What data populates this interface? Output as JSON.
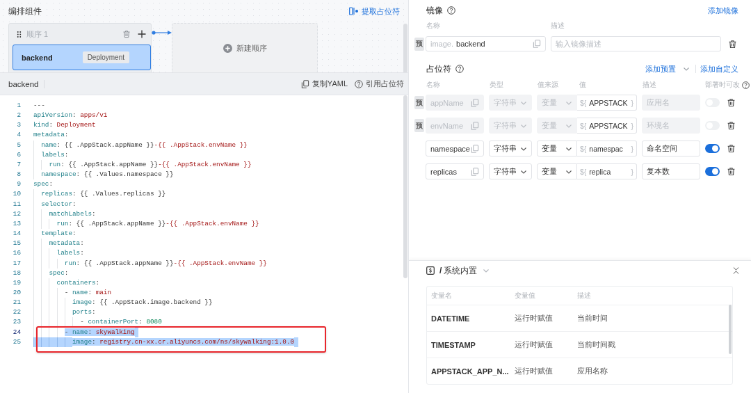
{
  "canvas": {
    "title": "编排组件",
    "extract_link": "提取占位符",
    "stages": [
      {
        "title": "顺序 1",
        "components": [
          {
            "name": "backend",
            "kind_tag": "Deployment",
            "selected": true
          }
        ]
      }
    ],
    "new_stage": "新建顺序"
  },
  "editor": {
    "title": "backend",
    "actions": [
      {
        "kind": "copy",
        "label": "复制YAML"
      },
      {
        "kind": "help",
        "label": "引用占位符"
      }
    ],
    "lines": [
      {
        "number": "1",
        "tokens": [
          {
            "kind": "punct",
            "text": "---"
          }
        ],
        "selected": false,
        "current": false,
        "outlined": false
      },
      {
        "number": "2",
        "tokens": [
          {
            "kind": "key",
            "text": "apiVersion"
          },
          {
            "kind": "punct",
            "text": ": "
          },
          {
            "kind": "string",
            "text": "apps/v1"
          }
        ],
        "selected": false,
        "current": false,
        "outlined": false
      },
      {
        "number": "3",
        "tokens": [
          {
            "kind": "key",
            "text": "kind"
          },
          {
            "kind": "punct",
            "text": ": "
          },
          {
            "kind": "string",
            "text": "Deployment"
          }
        ],
        "selected": false,
        "current": false,
        "outlined": false
      },
      {
        "number": "4",
        "tokens": [
          {
            "kind": "key",
            "text": "metadata"
          },
          {
            "kind": "punct",
            "text": ":"
          }
        ],
        "selected": false,
        "current": false,
        "outlined": false
      },
      {
        "number": "5",
        "tokens": [
          {
            "kind": "key",
            "text": "  name"
          },
          {
            "kind": "punct",
            "text": ": "
          },
          {
            "kind": "template",
            "text": "{{ .AppStack.appName }}"
          },
          {
            "kind": "string",
            "text": "-{{ .AppStack.envName }}"
          }
        ],
        "selected": false,
        "current": false,
        "outlined": false
      },
      {
        "number": "6",
        "tokens": [
          {
            "kind": "key",
            "text": "  labels"
          },
          {
            "kind": "punct",
            "text": ":"
          }
        ],
        "selected": false,
        "current": false,
        "outlined": false
      },
      {
        "number": "7",
        "tokens": [
          {
            "kind": "key",
            "text": "    run"
          },
          {
            "kind": "punct",
            "text": ": "
          },
          {
            "kind": "template",
            "text": "{{ .AppStack.appName }}"
          },
          {
            "kind": "string",
            "text": "-{{ .AppStack.envName }}"
          }
        ],
        "selected": false,
        "current": false,
        "outlined": false
      },
      {
        "number": "8",
        "tokens": [
          {
            "kind": "key",
            "text": "  namespace"
          },
          {
            "kind": "punct",
            "text": ": "
          },
          {
            "kind": "template",
            "text": "{{ .Values.namespace }}"
          }
        ],
        "selected": false,
        "current": false,
        "outlined": false
      },
      {
        "number": "9",
        "tokens": [
          {
            "kind": "key",
            "text": "spec"
          },
          {
            "kind": "punct",
            "text": ":"
          }
        ],
        "selected": false,
        "current": false,
        "outlined": false
      },
      {
        "number": "10",
        "tokens": [
          {
            "kind": "key",
            "text": "  replicas"
          },
          {
            "kind": "punct",
            "text": ": "
          },
          {
            "kind": "template",
            "text": "{{ .Values.replicas }}"
          }
        ],
        "selected": false,
        "current": false,
        "outlined": false
      },
      {
        "number": "11",
        "tokens": [
          {
            "kind": "key",
            "text": "  selector"
          },
          {
            "kind": "punct",
            "text": ":"
          }
        ],
        "selected": false,
        "current": false,
        "outlined": false
      },
      {
        "number": "12",
        "tokens": [
          {
            "kind": "key",
            "text": "    matchLabels"
          },
          {
            "kind": "punct",
            "text": ":"
          }
        ],
        "selected": false,
        "current": false,
        "outlined": false
      },
      {
        "number": "13",
        "tokens": [
          {
            "kind": "key",
            "text": "      run"
          },
          {
            "kind": "punct",
            "text": ": "
          },
          {
            "kind": "template",
            "text": "{{ .AppStack.appName }}"
          },
          {
            "kind": "string",
            "text": "-{{ .AppStack.envName }}"
          }
        ],
        "selected": false,
        "current": false,
        "outlined": false
      },
      {
        "number": "14",
        "tokens": [
          {
            "kind": "key",
            "text": "  template"
          },
          {
            "kind": "punct",
            "text": ":"
          }
        ],
        "selected": false,
        "current": false,
        "outlined": false
      },
      {
        "number": "15",
        "tokens": [
          {
            "kind": "key",
            "text": "    metadata"
          },
          {
            "kind": "punct",
            "text": ":"
          }
        ],
        "selected": false,
        "current": false,
        "outlined": false
      },
      {
        "number": "16",
        "tokens": [
          {
            "kind": "key",
            "text": "      labels"
          },
          {
            "kind": "punct",
            "text": ":"
          }
        ],
        "selected": false,
        "current": false,
        "outlined": false
      },
      {
        "number": "17",
        "tokens": [
          {
            "kind": "key",
            "text": "        run"
          },
          {
            "kind": "punct",
            "text": ": "
          },
          {
            "kind": "template",
            "text": "{{ .AppStack.appName }}"
          },
          {
            "kind": "string",
            "text": "-{{ .AppStack.envName }}"
          }
        ],
        "selected": false,
        "current": false,
        "outlined": false
      },
      {
        "number": "18",
        "tokens": [
          {
            "kind": "key",
            "text": "    spec"
          },
          {
            "kind": "punct",
            "text": ":"
          }
        ],
        "selected": false,
        "current": false,
        "outlined": false
      },
      {
        "number": "19",
        "tokens": [
          {
            "kind": "key",
            "text": "      containers"
          },
          {
            "kind": "punct",
            "text": ":"
          }
        ],
        "selected": false,
        "current": false,
        "outlined": false
      },
      {
        "number": "20",
        "tokens": [
          {
            "kind": "punct",
            "text": "        - "
          },
          {
            "kind": "key",
            "text": "name"
          },
          {
            "kind": "punct",
            "text": ": "
          },
          {
            "kind": "string",
            "text": "main"
          }
        ],
        "selected": false,
        "current": false,
        "outlined": false
      },
      {
        "number": "21",
        "tokens": [
          {
            "kind": "key",
            "text": "          image"
          },
          {
            "kind": "punct",
            "text": ": "
          },
          {
            "kind": "template",
            "text": "{{ .AppStack.image.backend }}"
          }
        ],
        "selected": false,
        "current": false,
        "outlined": false
      },
      {
        "number": "22",
        "tokens": [
          {
            "kind": "key",
            "text": "          ports"
          },
          {
            "kind": "punct",
            "text": ":"
          }
        ],
        "selected": false,
        "current": false,
        "outlined": false
      },
      {
        "number": "23",
        "tokens": [
          {
            "kind": "punct",
            "text": "            - "
          },
          {
            "kind": "key",
            "text": "containerPort"
          },
          {
            "kind": "punct",
            "text": ": "
          },
          {
            "kind": "number",
            "text": "8080"
          }
        ],
        "selected": false,
        "current": false,
        "outlined": false
      },
      {
        "number": "24",
        "tokens": [
          {
            "kind": "punct",
            "text": "        - "
          },
          {
            "kind": "key",
            "text": "name"
          },
          {
            "kind": "punct",
            "text": ": "
          },
          {
            "kind": "string",
            "text": "skywalking"
          }
        ],
        "selected": true,
        "current": true,
        "outlined": true
      },
      {
        "number": "25",
        "tokens": [
          {
            "kind": "key",
            "text": "          image"
          },
          {
            "kind": "punct",
            "text": ": "
          },
          {
            "kind": "string",
            "text": "registry.cn-xx.cr.aliyuncs.com/ns/skywalking:1.0.0"
          }
        ],
        "selected": true,
        "current": false,
        "outlined": true
      }
    ]
  },
  "image": {
    "title": "镜像",
    "add_link": "添加镜像",
    "columns": [
      "名称",
      "描述"
    ],
    "rows": [
      {
        "badge": "预",
        "prefix": "image.",
        "value": "backend",
        "description_placeholder": "输入镜像描述"
      }
    ]
  },
  "placeholders": {
    "title": "占位符",
    "add_preset": "添加预置",
    "add_custom": "添加自定义",
    "columns": [
      "名称",
      "类型",
      "值来源",
      "值",
      "描述",
      "部署时可改"
    ],
    "rows": [
      {
        "badge": "预",
        "name": "appName",
        "type": "字符串",
        "source": "变量",
        "value_prefix": "${",
        "value": "APPSTACK",
        "value_suffix": "}",
        "description": "应用名",
        "disabled": true,
        "editable_on_deploy": false
      },
      {
        "badge": "预",
        "name": "envName",
        "type": "字符串",
        "source": "变量",
        "value_prefix": "${",
        "value": "APPSTACK",
        "value_suffix": "}",
        "description": "环境名",
        "disabled": true,
        "editable_on_deploy": false
      },
      {
        "name": "namespace",
        "type": "字符串",
        "source": "变量",
        "value_prefix": "${",
        "value": "namespac",
        "value_suffix": "}",
        "description": "命名空间",
        "disabled": false,
        "editable_on_deploy": true
      },
      {
        "name": "replicas",
        "type": "字符串",
        "source": "变量",
        "value_prefix": "${",
        "value": "replica",
        "value_suffix": "}",
        "description": "复本数",
        "disabled": false,
        "editable_on_deploy": true
      }
    ]
  },
  "builtin_panel": {
    "separator": "/",
    "title": "系统内置",
    "columns": [
      "变量名",
      "变量值",
      "描述"
    ],
    "rows": [
      {
        "name": "DATETIME",
        "value": "运行时赋值",
        "description": "当前时间"
      },
      {
        "name": "TIMESTAMP",
        "value": "运行时赋值",
        "description": "当前时间戳"
      },
      {
        "name": "APPSTACK_APP_N...",
        "value": "运行时赋值",
        "description": "应用名称"
      }
    ]
  }
}
